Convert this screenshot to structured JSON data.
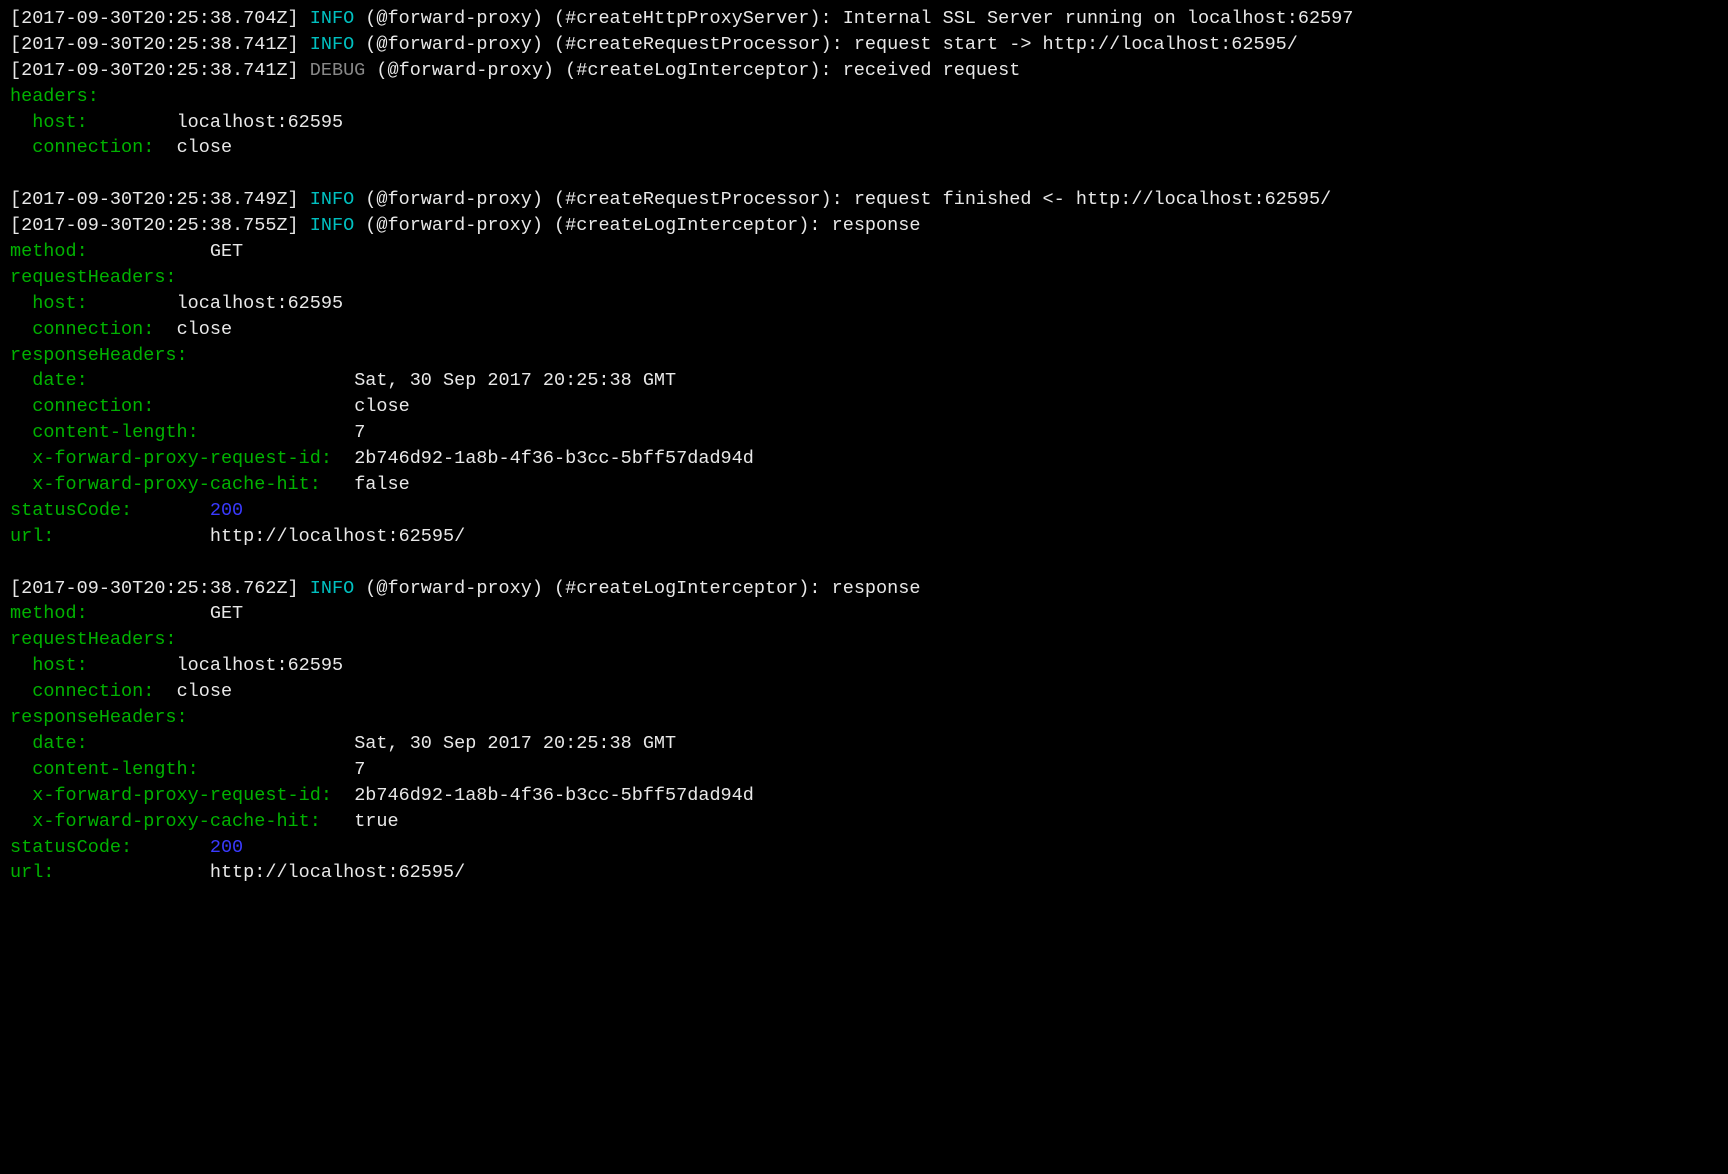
{
  "colors": {
    "background": "#000000",
    "text": "#e8e8e8",
    "level_info": "#00c0c0",
    "level_debug": "#888888",
    "key": "#00b200",
    "number": "#3a3aff"
  },
  "lines": [
    {
      "type": "log",
      "ts": "[2017-09-30T20:25:38.704Z]",
      "level": "INFO",
      "namespace": "(@forward-proxy)",
      "context": "(#createHttpProxyServer):",
      "message": "Internal SSL Server running on localhost:62597"
    },
    {
      "type": "log",
      "ts": "[2017-09-30T20:25:38.741Z]",
      "level": "INFO",
      "namespace": "(@forward-proxy)",
      "context": "(#createRequestProcessor):",
      "message": "request start -> http://localhost:62595/"
    },
    {
      "type": "log",
      "ts": "[2017-09-30T20:25:38.741Z]",
      "level": "DEBUG",
      "namespace": "(@forward-proxy)",
      "context": "(#createLogInterceptor):",
      "message": "received request"
    },
    {
      "type": "kv",
      "indent": 0,
      "key": "headers:",
      "value": ""
    },
    {
      "type": "kv",
      "indent": 1,
      "key": "host:",
      "pad": 12,
      "value": "localhost:62595"
    },
    {
      "type": "kv",
      "indent": 1,
      "key": "connection:",
      "pad": 12,
      "value": "close"
    },
    {
      "type": "blank"
    },
    {
      "type": "log",
      "ts": "[2017-09-30T20:25:38.749Z]",
      "level": "INFO",
      "namespace": "(@forward-proxy)",
      "context": "(#createRequestProcessor):",
      "message": "request finished <- http://localhost:62595/"
    },
    {
      "type": "log",
      "ts": "[2017-09-30T20:25:38.755Z]",
      "level": "INFO",
      "namespace": "(@forward-proxy)",
      "context": "(#createLogInterceptor):",
      "message": "response"
    },
    {
      "type": "kv",
      "indent": 0,
      "key": "method:",
      "pad": 17,
      "value": "GET"
    },
    {
      "type": "kv",
      "indent": 0,
      "key": "requestHeaders:",
      "value": ""
    },
    {
      "type": "kv",
      "indent": 1,
      "key": "host:",
      "pad": 12,
      "value": "localhost:62595"
    },
    {
      "type": "kv",
      "indent": 1,
      "key": "connection:",
      "pad": 12,
      "value": "close"
    },
    {
      "type": "kv",
      "indent": 0,
      "key": "responseHeaders:",
      "value": ""
    },
    {
      "type": "kv",
      "indent": 1,
      "key": "date:",
      "pad": 28,
      "value": "Sat, 30 Sep 2017 20:25:38 GMT"
    },
    {
      "type": "kv",
      "indent": 1,
      "key": "connection:",
      "pad": 28,
      "value": "close"
    },
    {
      "type": "kv",
      "indent": 1,
      "key": "content-length:",
      "pad": 28,
      "value": "7"
    },
    {
      "type": "kv",
      "indent": 1,
      "key": "x-forward-proxy-request-id:",
      "pad": 28,
      "value": "2b746d92-1a8b-4f36-b3cc-5bff57dad94d"
    },
    {
      "type": "kv",
      "indent": 1,
      "key": "x-forward-proxy-cache-hit:",
      "pad": 28,
      "value": "false"
    },
    {
      "type": "kv",
      "indent": 0,
      "key": "statusCode:",
      "pad": 17,
      "value": "200",
      "valueClass": "num"
    },
    {
      "type": "kv",
      "indent": 0,
      "key": "url:",
      "pad": 17,
      "value": "http://localhost:62595/"
    },
    {
      "type": "blank"
    },
    {
      "type": "log",
      "ts": "[2017-09-30T20:25:38.762Z]",
      "level": "INFO",
      "namespace": "(@forward-proxy)",
      "context": "(#createLogInterceptor):",
      "message": "response"
    },
    {
      "type": "kv",
      "indent": 0,
      "key": "method:",
      "pad": 17,
      "value": "GET"
    },
    {
      "type": "kv",
      "indent": 0,
      "key": "requestHeaders:",
      "value": ""
    },
    {
      "type": "kv",
      "indent": 1,
      "key": "host:",
      "pad": 12,
      "value": "localhost:62595"
    },
    {
      "type": "kv",
      "indent": 1,
      "key": "connection:",
      "pad": 12,
      "value": "close"
    },
    {
      "type": "kv",
      "indent": 0,
      "key": "responseHeaders:",
      "value": ""
    },
    {
      "type": "kv",
      "indent": 1,
      "key": "date:",
      "pad": 28,
      "value": "Sat, 30 Sep 2017 20:25:38 GMT"
    },
    {
      "type": "kv",
      "indent": 1,
      "key": "content-length:",
      "pad": 28,
      "value": "7"
    },
    {
      "type": "kv",
      "indent": 1,
      "key": "x-forward-proxy-request-id:",
      "pad": 28,
      "value": "2b746d92-1a8b-4f36-b3cc-5bff57dad94d"
    },
    {
      "type": "kv",
      "indent": 1,
      "key": "x-forward-proxy-cache-hit:",
      "pad": 28,
      "value": "true"
    },
    {
      "type": "kv",
      "indent": 0,
      "key": "statusCode:",
      "pad": 17,
      "value": "200",
      "valueClass": "num"
    },
    {
      "type": "kv",
      "indent": 0,
      "key": "url:",
      "pad": 17,
      "value": "http://localhost:62595/"
    }
  ]
}
